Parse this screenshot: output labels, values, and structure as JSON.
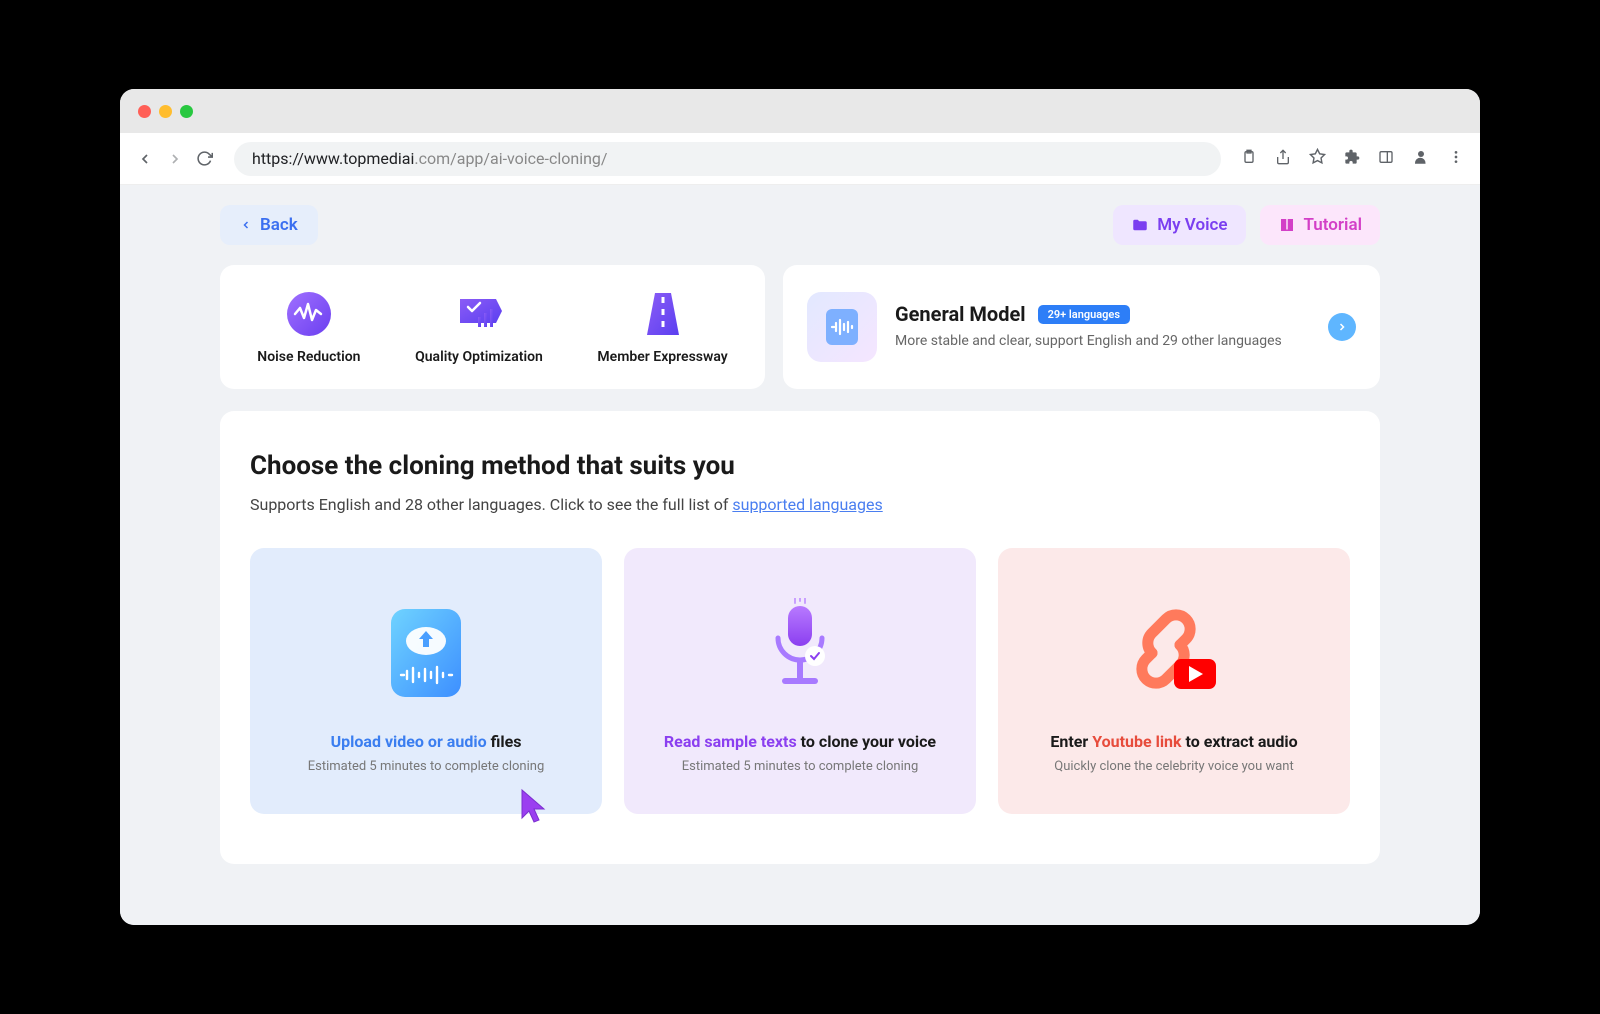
{
  "url_gray_prefix": "https://www.topmediai",
  "url_rest": ".com/app/ai-voice-cloning/",
  "back_label": "Back",
  "my_voice_label": "My Voice",
  "tutorial_label": "Tutorial",
  "features": {
    "noise": "Noise Reduction",
    "quality": "Quality Optimization",
    "expressway": "Member Expressway"
  },
  "model": {
    "title": "General Model",
    "badge": "29+ languages",
    "desc": "More stable and clear, support English and 29 other languages"
  },
  "main": {
    "title": "Choose the cloning method that suits you",
    "subtitle_pre": "Supports English and 28 other languages. Click to see the full list of ",
    "subtitle_link": "supported languages"
  },
  "methods": {
    "upload": {
      "highlight": "Upload video or audio",
      "rest": " files",
      "sub": "Estimated 5 minutes to complete cloning"
    },
    "read": {
      "highlight": "Read sample texts",
      "rest": " to clone your voice",
      "sub": "Estimated 5 minutes to complete cloning"
    },
    "youtube": {
      "pre": "Enter ",
      "highlight": "Youtube link",
      "rest": " to extract audio",
      "sub": "Quickly clone the celebrity voice you want"
    }
  }
}
